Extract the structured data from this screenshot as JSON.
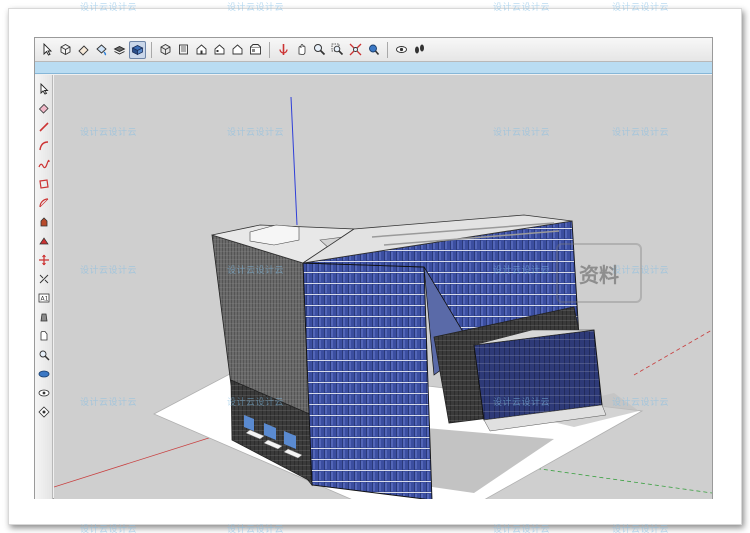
{
  "toolbar": {
    "icons": [
      "select-icon",
      "component-icon",
      "eraser-icon",
      "paint-icon",
      "layers-icon",
      "shaded-icon",
      "iso-icon",
      "top-view-icon",
      "front-view-icon",
      "right-view-icon",
      "back-view-icon",
      "left-view-icon",
      "orbit-icon",
      "pan-icon",
      "zoom-icon",
      "zoom-window-icon",
      "zoom-extents-icon",
      "previous-view-icon",
      "walk-icon",
      "footprint-icon"
    ]
  },
  "left_tools": [
    "select-tool",
    "eraser-tool",
    "line-tool",
    "arc-tool",
    "freehand-tool",
    "rectangle-tool",
    "pushpull-tool",
    "move-tool",
    "rotate-tool",
    "offset-tool",
    "tape-tool",
    "text-tool",
    "paint-tool",
    "orbit-tool",
    "pan-tool",
    "zoom-tool",
    "walk-tool",
    "lookaround-tool"
  ],
  "watermark": {
    "text": "设计云设计云",
    "big_text": "资料"
  },
  "colors": {
    "viewport_bg": "#cfcfcf",
    "facade_blue": "#3a4fa0",
    "axis_blue": "#2f3fd8",
    "axis_red": "#c84040",
    "axis_green": "#3aa040"
  }
}
